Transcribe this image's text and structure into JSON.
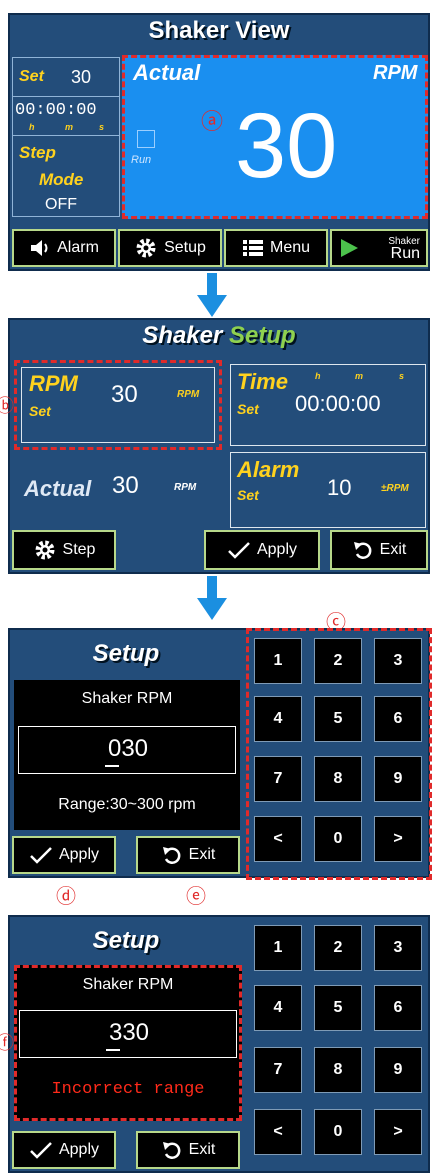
{
  "screen1": {
    "title": "Shaker View",
    "set_label": "Set",
    "set_value": "30",
    "timer": "00:00:00",
    "timer_units": [
      "h",
      "m",
      "s"
    ],
    "step_label": "Step",
    "mode_label": "Mode",
    "mode_value": "OFF",
    "actual_label": "Actual",
    "rpm_label": "RPM",
    "run_label": "Run",
    "big_value": "30",
    "marker": "ⓐ",
    "buttons": {
      "alarm": "Alarm",
      "setup": "Setup",
      "menu": "Menu",
      "shaker_top": "Shaker",
      "shaker_bottom": "Run"
    }
  },
  "screen2": {
    "title_a": "Shaker",
    "title_b": "Setup",
    "rpm_label": "RPM",
    "rpm_set": "Set",
    "rpm_value": "30",
    "rpm_unit": "RPM",
    "time_label": "Time",
    "time_set": "Set",
    "time_value": "00:00:00",
    "time_units": [
      "h",
      "m",
      "s"
    ],
    "actual_label": "Actual",
    "actual_value": "30",
    "actual_unit": "RPM",
    "alarm_label": "Alarm",
    "alarm_set": "Set",
    "alarm_value": "10",
    "alarm_unit": "±RPM",
    "marker": "ⓑ",
    "buttons": {
      "step": "Step",
      "apply": "Apply",
      "exit": "Exit"
    }
  },
  "screen3": {
    "title": "Setup",
    "label": "Shaker RPM",
    "value": "030",
    "range": "Range:30~300 rpm",
    "keys": [
      "1",
      "2",
      "3",
      "4",
      "5",
      "6",
      "7",
      "8",
      "9",
      "<",
      "0",
      ">"
    ],
    "buttons": {
      "apply": "Apply",
      "exit": "Exit"
    },
    "marker_c": "ⓒ",
    "marker_d": "ⓓ",
    "marker_e": "ⓔ"
  },
  "screen4": {
    "title": "Setup",
    "label": "Shaker RPM",
    "value": "330",
    "error": "Incorrect range",
    "keys": [
      "1",
      "2",
      "3",
      "4",
      "5",
      "6",
      "7",
      "8",
      "9",
      "<",
      "0",
      ">"
    ],
    "buttons": {
      "apply": "Apply",
      "exit": "Exit"
    },
    "marker_f": "ⓕ"
  },
  "colors": {
    "panel": "#234d7a",
    "accent_yellow": "#ffd21e",
    "actual_blue": "#1a8ff0",
    "highlight_red": "#e02a2a",
    "button_border": "#b7d88a",
    "arrow": "#1b8fe0"
  }
}
